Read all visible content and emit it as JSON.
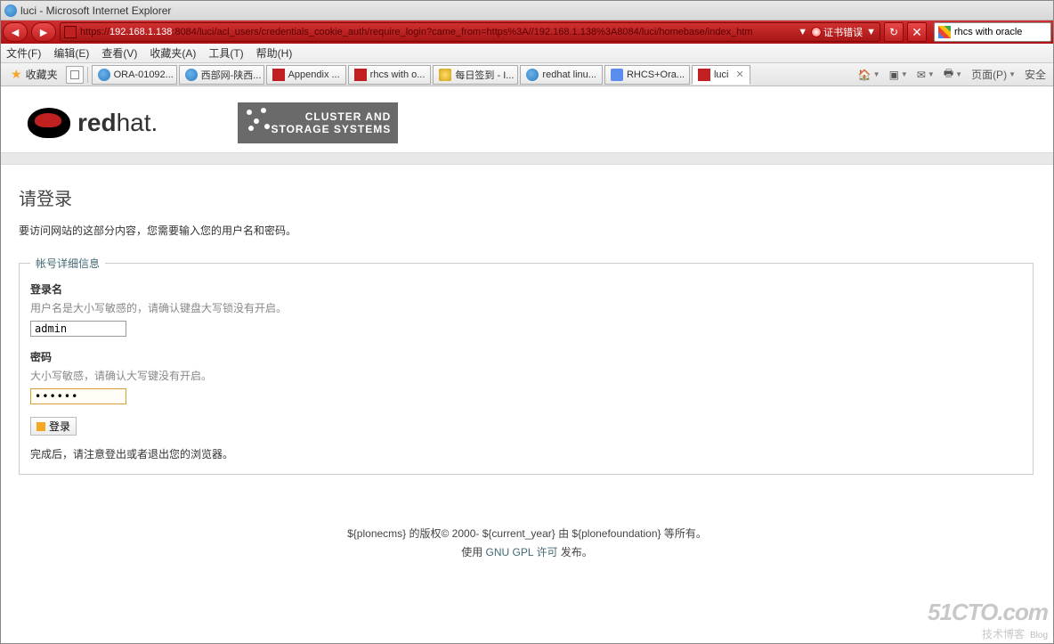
{
  "window": {
    "title": "luci - Microsoft Internet Explorer"
  },
  "address": {
    "scheme": "https://",
    "host": "192.168.1.138",
    "rest": ":8084/luci/acl_users/credentials_cookie_auth/require_login?came_from=https%3A//192.168.1.138%3A8084/luci/homebase/index_htm",
    "cert_error": "证书错误"
  },
  "search": {
    "placeholder": "",
    "value": "rhcs with oracle"
  },
  "menu": {
    "file": "文件(F)",
    "edit": "编辑(E)",
    "view": "查看(V)",
    "favorites": "收藏夹(A)",
    "tools": "工具(T)",
    "help": "帮助(H)"
  },
  "favbar": {
    "favorites_label": "收藏夹"
  },
  "tabs": [
    {
      "label": "ORA-01092...",
      "icon": "ie"
    },
    {
      "label": "西部网-陕西...",
      "icon": "ie"
    },
    {
      "label": "Appendix ...",
      "icon": "rh"
    },
    {
      "label": "rhcs with o...",
      "icon": "rh"
    },
    {
      "label": "每日签到 - I...",
      "icon": "trophy"
    },
    {
      "label": "redhat linu...",
      "icon": "ie"
    },
    {
      "label": "RHCS+Ora...",
      "icon": "paw"
    },
    {
      "label": "luci",
      "icon": "rh",
      "active": true
    }
  ],
  "toolbar": {
    "page": "页面(P)",
    "safety": "安全"
  },
  "logo": {
    "brand_bold": "red",
    "brand_rest": "hat.",
    "cluster_l1": "CLUSTER AND",
    "cluster_l2": "STORAGE SYSTEMS"
  },
  "login": {
    "heading": "请登录",
    "subtitle": "要访问网站的这部分内容，您需要输入您的用户名和密码。",
    "legend": "帐号详细信息",
    "username_label": "登录名",
    "username_help": "用户名是大小写敏感的，请确认键盘大写锁没有开启。",
    "username_value": "admin",
    "password_label": "密码",
    "password_help": "大小写敏感，请确认大写键没有开启。",
    "password_value": "••••••",
    "button": "登录",
    "after": "完成后，请注意登出或者退出您的浏览器。"
  },
  "footer": {
    "line1_a": "${plonecms} 的版权© 2000- ${current_year} 由 ${plonefoundation} 等所有。",
    "line2_pre": "使用 ",
    "line2_link": "GNU GPL 许可",
    "line2_post": " 发布。"
  },
  "watermark": {
    "big": "51CTO.com",
    "small": "技术博客",
    "blog": "Blog"
  }
}
